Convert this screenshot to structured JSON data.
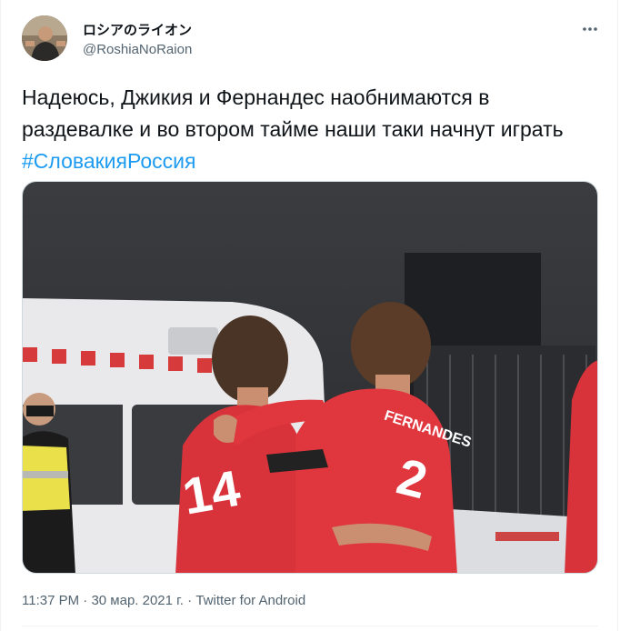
{
  "author": {
    "name": "ロシアのライオン",
    "handle": "@RoshiaNoRaion"
  },
  "tweet": {
    "text": "Надеюсь, Джикия и Фернандес наобнимаются в раздевалке и во втором тайме наши таки начнут играть ",
    "hashtag": "#СловакияРоссия"
  },
  "media": {
    "description_icon": "photo-icon",
    "jersey_name": "FERNANDES",
    "jersey_number": "2",
    "back_number": "14"
  },
  "meta": {
    "time": "11:37 PM",
    "date": "30 мар. 2021 г.",
    "client": "Twitter for Android",
    "separator": "·"
  },
  "colors": {
    "accent": "#1d9bf0",
    "text": "#0f1419",
    "secondary": "#536471"
  },
  "icons": {
    "more": "more-dots-icon"
  }
}
